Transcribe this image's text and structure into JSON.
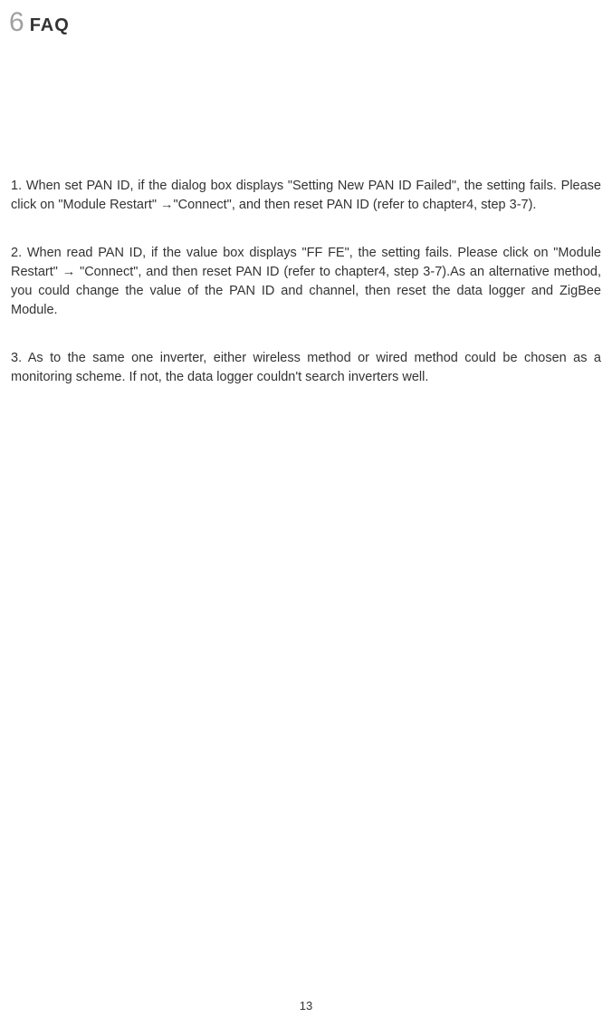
{
  "header": {
    "chapter_number": "6",
    "chapter_title": "FAQ"
  },
  "paragraphs": [
    "1. When set PAN ID, if the dialog box displays \"Setting New PAN ID Failed\", the setting fails. Please click on \"Module Restart\" →\"Connect\", and then reset PAN ID (refer to chapter4, step 3-7).",
    "2. When read PAN ID, if the value box displays \"FF FE\", the setting fails. Please click on \"Module Restart\" → \"Connect\", and then reset PAN ID (refer to chapter4, step 3-7).As an alternative method, you could change the value of the PAN ID and channel, then reset the data logger and ZigBee Module.",
    "3. As to the same one inverter, either wireless method or wired method could be chosen as a monitoring scheme. If not, the data logger couldn't search inverters well."
  ],
  "page_number": "13"
}
